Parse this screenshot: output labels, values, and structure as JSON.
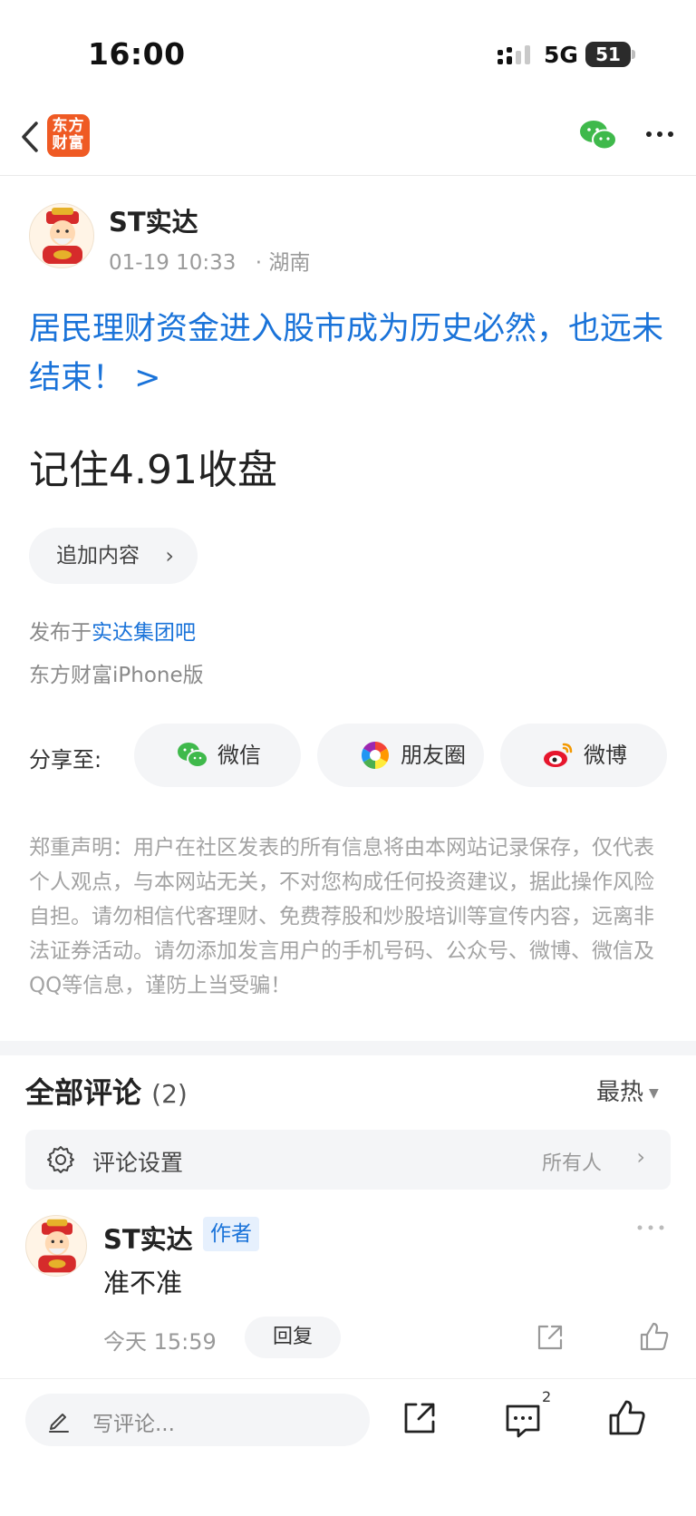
{
  "status_bar": {
    "time": "16:00",
    "network": "5G",
    "battery": "51"
  },
  "nav": {
    "logo_text": "东方\n财富",
    "back_icon": "chevron-left-icon",
    "wechat_icon": "wechat-icon",
    "more_icon": "more-dots-icon"
  },
  "post": {
    "author_name": "ST实达",
    "datetime": "01-19 10:33",
    "location": "· 湖南",
    "headline": "居民理财资金进入股市成为历史必然，也远未结束！ >",
    "body": "记住4.91收盘",
    "append_label": "追加内容",
    "posted_in_prefix": "发布于",
    "posted_in_link": "实达集团吧",
    "client": "东方财富iPhone版"
  },
  "share": {
    "label": "分享至:",
    "targets": [
      {
        "label": "微信",
        "icon": "wechat-icon"
      },
      {
        "label": "朋友圈",
        "icon": "moments-icon"
      },
      {
        "label": "微博",
        "icon": "weibo-icon"
      }
    ]
  },
  "disclaimer": "郑重声明：用户在社区发表的所有信息将由本网站记录保存，仅代表个人观点，与本网站无关，不对您构成任何投资建议，据此操作风险自担。请勿相信代客理财、免费荐股和炒股培训等宣传内容，远离非法证券活动。请勿添加发言用户的手机号码、公众号、微博、微信及QQ等信息，谨防上当受骗！",
  "comments": {
    "title": "全部评论",
    "count": "(2)",
    "sort_label": "最热",
    "settings_label": "评论设置",
    "settings_value": "所有人",
    "items": [
      {
        "name": "ST实达",
        "badge": "作者",
        "text": "准不准",
        "time": "今天 15:59",
        "reply_label": "回复"
      }
    ]
  },
  "bottom_bar": {
    "placeholder": "写评论...",
    "comment_count": "2"
  },
  "colors": {
    "link_blue": "#1a73d9",
    "brand_orange": "#ef5a24",
    "wechat_green": "#3fb94b",
    "weibo_red": "#e6162d"
  }
}
